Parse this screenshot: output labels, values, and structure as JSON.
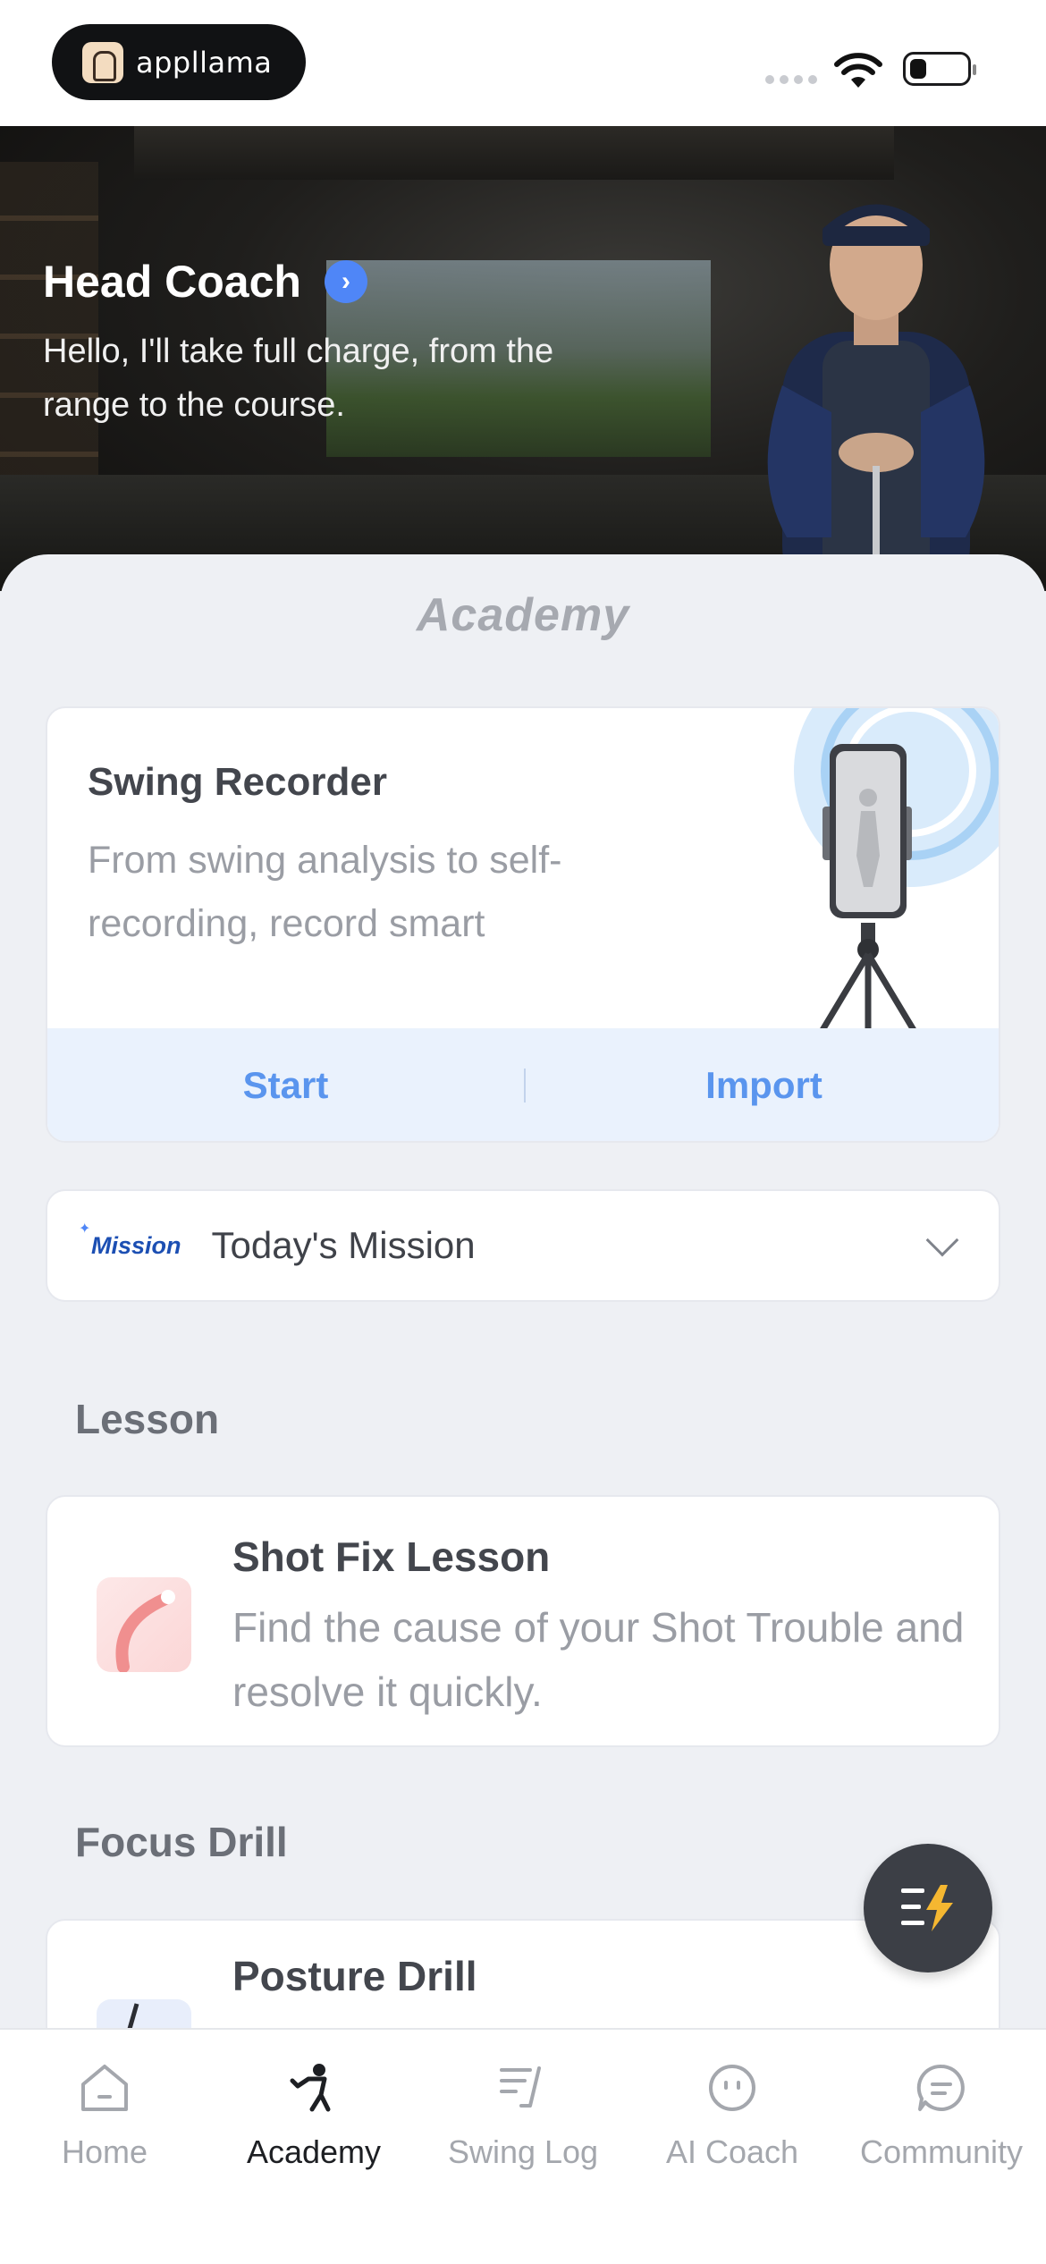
{
  "status_bar": {
    "app_badge": "appllama"
  },
  "hero": {
    "title": "Head Coach",
    "subtitle": "Hello, I'll take full charge, from the range to the course."
  },
  "page": {
    "title": "Academy"
  },
  "swing_recorder": {
    "title": "Swing Recorder",
    "description": "From swing analysis to self-recording, record smart",
    "start_label": "Start",
    "import_label": "Import"
  },
  "mission": {
    "logo_text": "Mission",
    "label": "Today's Mission"
  },
  "lesson": {
    "section_title": "Lesson",
    "card_title": "Shot Fix Lesson",
    "card_description": "Find the cause of your Shot Trouble and resolve it quickly."
  },
  "focus_drill": {
    "section_title": "Focus Drill",
    "card_title": "Posture Drill"
  },
  "tabbar": {
    "items": [
      {
        "label": "Home",
        "icon": "home-icon"
      },
      {
        "label": "Academy",
        "icon": "academy-icon"
      },
      {
        "label": "Swing Log",
        "icon": "swing-log-icon"
      },
      {
        "label": "AI Coach",
        "icon": "ai-coach-icon"
      },
      {
        "label": "Community",
        "icon": "community-icon"
      }
    ],
    "active": "Academy"
  },
  "colors": {
    "accent": "#4f86f7",
    "button_text": "#5a95ee",
    "background": "#eef0f4"
  }
}
